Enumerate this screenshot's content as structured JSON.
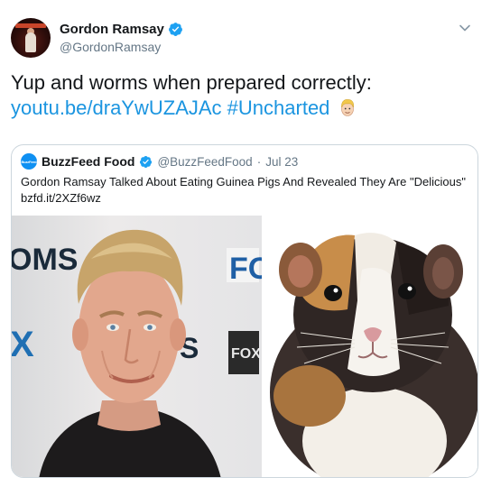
{
  "tweet": {
    "display_name": "Gordon Ramsay",
    "handle": "@GordonRamsay",
    "verified": true,
    "text_line1": "Yup and worms when prepared correctly:",
    "link": "youtu.be/draYwUZAJAc",
    "hashtag": "#Uncharted",
    "emoji": "blond-chef-face-emoji"
  },
  "quoted_tweet": {
    "display_name": "BuzzFeed Food",
    "handle": "@BuzzFeedFood",
    "separator": "·",
    "date": "Jul 23",
    "verified": true,
    "avatar_text": "BuzzFeed",
    "text": "Gordon Ramsay Talked About Eating Guinea Pigs And Revealed They Are \"Delicious\"",
    "short_link": "bzfd.it/2XZf6wz",
    "media": [
      {
        "subject": "gordon-ramsay-portrait",
        "backdrop_text": [
          "OMS",
          "X",
          "S",
          "FO",
          "FOX"
        ]
      },
      {
        "subject": "guinea-pig-photo"
      }
    ]
  },
  "colors": {
    "link": "#1b95e0",
    "verified": "#1da1f2",
    "muted": "#657786",
    "border": "#ccd6dd"
  },
  "icons": {
    "menu": "chevron-down-icon",
    "verified": "verified-badge-icon"
  }
}
